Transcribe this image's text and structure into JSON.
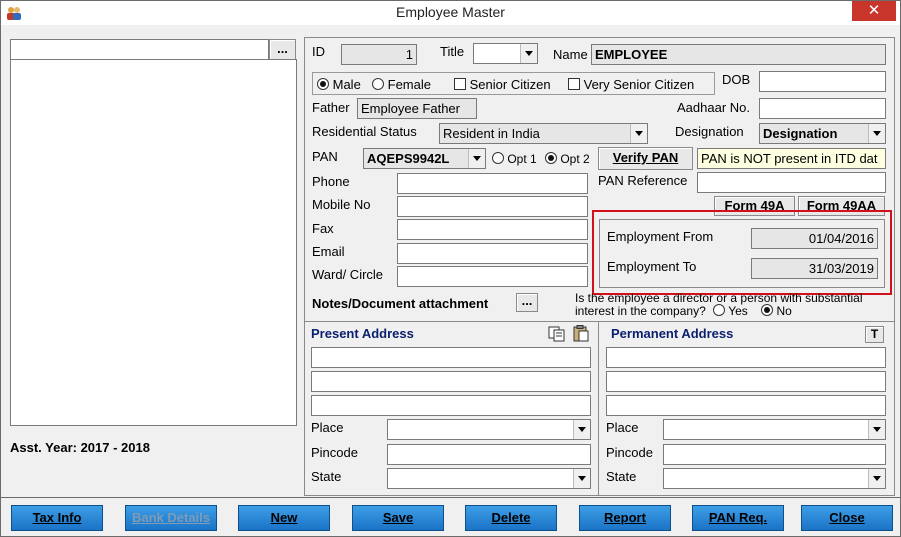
{
  "window": {
    "title": "Employee Master"
  },
  "search": {
    "value": "",
    "browse_label": "..."
  },
  "footer": {
    "asst_year": "Asst. Year: 2017 - 2018"
  },
  "form": {
    "id_label": "ID",
    "id_value": "1",
    "title_label": "Title",
    "title_value": "",
    "name_label": "Name",
    "name_value": "EMPLOYEE",
    "male_label": "Male",
    "female_label": "Female",
    "senior_label": "Senior Citizen",
    "very_senior_label": "Very Senior Citizen",
    "dob_label": "DOB",
    "dob_value": "",
    "father_label": "Father",
    "father_value": "Employee Father",
    "aadhaar_label": "Aadhaar No.",
    "aadhaar_value": "",
    "res_status_label": "Residential Status",
    "res_status_value": "Resident in India",
    "designation_label": "Designation",
    "designation_value": "Designation",
    "pan_label": "PAN",
    "pan_value": "AQEPS9942L",
    "opt1_label": "Opt 1",
    "opt2_label": "Opt 2",
    "verify_pan_label": "Verify PAN",
    "pan_status": "PAN is NOT present in ITD dat",
    "phone_label": "Phone",
    "phone_value": "",
    "pan_ref_label": "PAN Reference",
    "pan_ref_value": "",
    "mobile_label": "Mobile No",
    "mobile_value": "",
    "form49a_label": "Form 49A",
    "form49aa_label": "Form 49AA",
    "fax_label": "Fax",
    "fax_value": "",
    "email_label": "Email",
    "email_value": "",
    "ward_label": "Ward/ Circle",
    "ward_value": "",
    "emp_from_label": "Employment From",
    "emp_from_value": "01/04/2016",
    "emp_to_label": "Employment To",
    "emp_to_value": "31/03/2019",
    "notes_label": "Notes/Document attachment",
    "notes_btn": "...",
    "director_q1": "Is the employee a director or a person with substantial",
    "director_q2": "interest in the company?",
    "yes_label": "Yes",
    "no_label": "No"
  },
  "present": {
    "title": "Present Address",
    "line1": "",
    "line2": "",
    "line3": "",
    "place_label": "Place",
    "place_value": "",
    "pincode_label": "Pincode",
    "pincode_value": "",
    "state_label": "State",
    "state_value": ""
  },
  "permanent": {
    "title": "Permanent Address",
    "t_button": "T",
    "line1": "",
    "line2": "",
    "line3": "",
    "place_label": "Place",
    "place_value": "",
    "pincode_label": "Pincode",
    "pincode_value": "",
    "state_label": "State",
    "state_value": ""
  },
  "buttons": {
    "tax_info": "Tax Info",
    "bank_details": "Bank Details",
    "new": "New",
    "save": "Save",
    "delete": "Delete",
    "report": "Report",
    "pan_req": "PAN Req.",
    "close": "Close"
  },
  "colors": {
    "highlight": "#d0101a",
    "button_blue": "#1b73c6",
    "section_title": "#0a1f6e"
  }
}
